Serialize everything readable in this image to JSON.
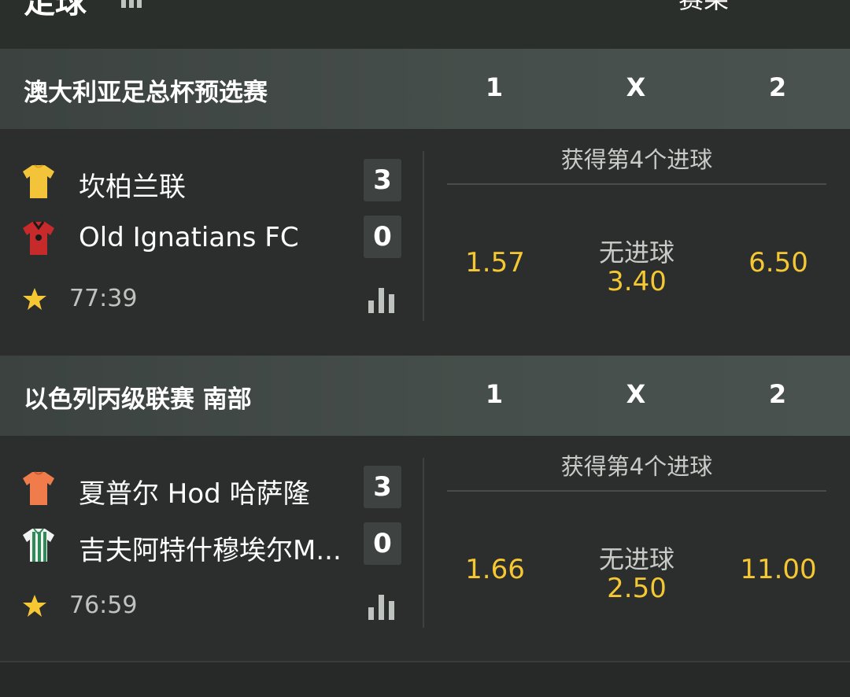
{
  "top": {
    "title": "足球",
    "right_label": "赛果"
  },
  "colors": {
    "odds": "#f5c833",
    "star": "#f5c833",
    "background": "#2b2e2c",
    "header": "#464e4b"
  },
  "leagues": [
    {
      "name": "澳大利亚足总杯预选赛",
      "cols": [
        "1",
        "X",
        "2"
      ],
      "match": {
        "home": {
          "name": "坎柏兰联",
          "score": "3",
          "shirt": "yellow-shirt-icon"
        },
        "away": {
          "name": "Old Ignatians FC",
          "score": "0",
          "shirt": "red-shirt-icon"
        },
        "time": "77:39",
        "market": "获得第4个进球",
        "odds_home": "1.57",
        "draw_label": "无进球",
        "odds_draw": "3.40",
        "odds_away": "6.50"
      }
    },
    {
      "name": "以色列丙级联赛 南部",
      "cols": [
        "1",
        "X",
        "2"
      ],
      "match": {
        "home": {
          "name": "夏普尔 Hod 哈萨隆",
          "score": "3",
          "shirt": "orange-shirt-icon"
        },
        "away": {
          "name": "吉夫阿特什穆埃尔M...",
          "score": "0",
          "shirt": "green-striped-shirt-icon"
        },
        "time": "76:59",
        "market": "获得第4个进球",
        "odds_home": "1.66",
        "draw_label": "无进球",
        "odds_draw": "2.50",
        "odds_away": "11.00"
      }
    }
  ]
}
